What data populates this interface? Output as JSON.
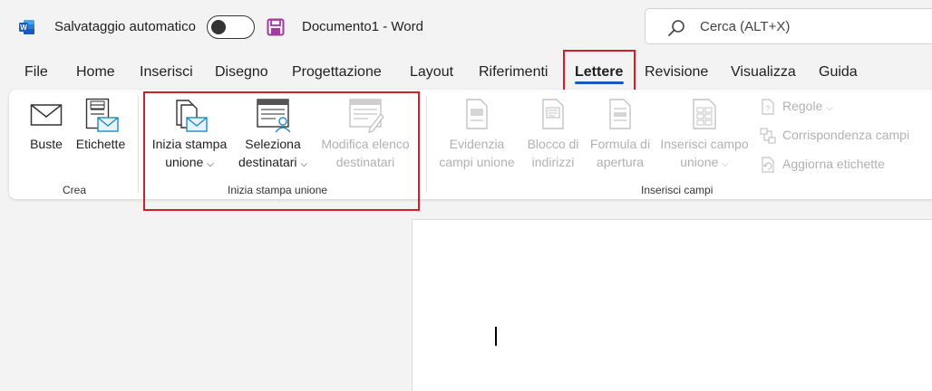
{
  "titlebar": {
    "autosave_label": "Salvataggio automatico",
    "doc_title": "Documento1  -  Word"
  },
  "search": {
    "placeholder": "Cerca (ALT+X)"
  },
  "tabs": [
    {
      "label": "File"
    },
    {
      "label": "Home"
    },
    {
      "label": "Inserisci"
    },
    {
      "label": "Disegno"
    },
    {
      "label": "Progettazione"
    },
    {
      "label": "Layout"
    },
    {
      "label": "Riferimenti"
    },
    {
      "label": "Lettere"
    },
    {
      "label": "Revisione"
    },
    {
      "label": "Visualizza"
    },
    {
      "label": "Guida"
    }
  ],
  "ribbon": {
    "crea": {
      "label": "Crea",
      "buste": "Buste",
      "etichette": "Etichette"
    },
    "inizia": {
      "label": "Inizia stampa unione",
      "inizia_line1": "Inizia stampa",
      "inizia_line2": "unione",
      "seleziona_line1": "Seleziona",
      "seleziona_line2": "destinatari",
      "modifica_line1": "Modifica elenco",
      "modifica_line2": "destinatari"
    },
    "inserisci": {
      "label": "Inserisci campi",
      "evidenzia_line1": "Evidenzia",
      "evidenzia_line2": "campi unione",
      "blocco_line1": "Blocco di",
      "blocco_line2": "indirizzi",
      "formula_line1": "Formula di",
      "formula_line2": "apertura",
      "inserisci_line1": "Inserisci campo",
      "inserisci_line2": "unione",
      "regole": "Regole",
      "corrispondenza": "Corrispondenza campi",
      "aggiorna": "Aggiorna etichette"
    }
  },
  "colors": {
    "accent": "#185abd",
    "highlight": "#d11f2a",
    "save_icon": "#a33a9e",
    "disabled_text": "#b1b1b1"
  }
}
